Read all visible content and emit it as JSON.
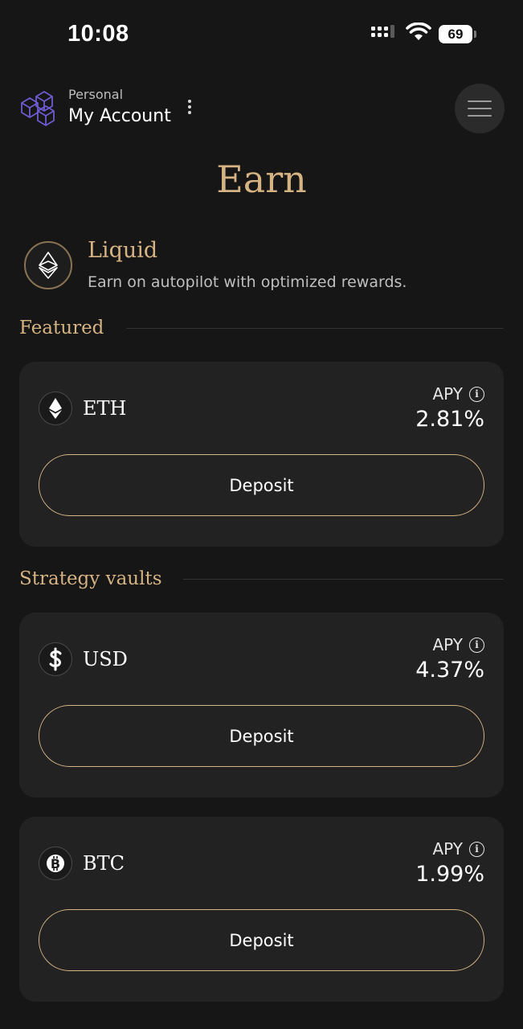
{
  "status_bar": {
    "time": "10:08",
    "battery": "69"
  },
  "header": {
    "account_type": "Personal",
    "account_name": "My Account"
  },
  "page": {
    "title": "Earn"
  },
  "liquid": {
    "title": "Liquid",
    "description": "Earn on autopilot with optimized rewards."
  },
  "sections": {
    "featured": "Featured",
    "strategy_vaults": "Strategy vaults"
  },
  "vaults": [
    {
      "token": "ETH",
      "icon": "eth-icon",
      "apy_label": "APY",
      "apy": "2.81%",
      "button": "Deposit"
    },
    {
      "token": "USD",
      "icon": "dollar-icon",
      "apy_label": "APY",
      "apy": "4.37%",
      "button": "Deposit"
    },
    {
      "token": "BTC",
      "icon": "bitcoin-icon",
      "apy_label": "APY",
      "apy": "1.99%",
      "button": "Deposit"
    }
  ],
  "colors": {
    "background": "#161616",
    "card": "#222222",
    "accent_gold": "#d6b383",
    "logo_purple": "#6d5bd0"
  }
}
